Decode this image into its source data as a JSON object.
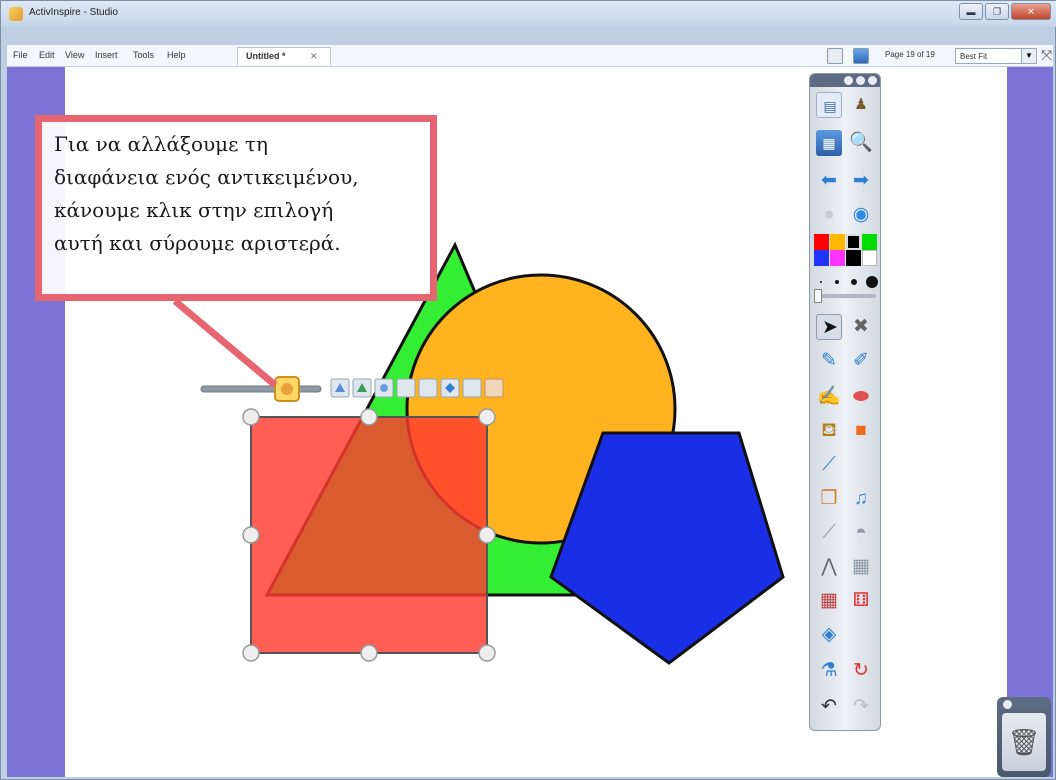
{
  "window": {
    "title": "ActivInspire - Studio"
  },
  "menu": {
    "items": [
      "File",
      "Edit",
      "View",
      "Insert",
      "Tools",
      "Help"
    ],
    "doc_tab": "Untitled *",
    "doc_tab_close": "✕"
  },
  "page_indicator": "Page 19 of 19",
  "zoom": {
    "selected": "Best Fit"
  },
  "callout": {
    "lines": [
      "Για να αλλάξουμε τη",
      "διαφάνεια ενός αντικειμένου,",
      "κάνουμε κλικ στην επιλογή",
      "αυτή και σύρουμε αριστερά."
    ]
  },
  "shapes": [
    {
      "name": "triangle",
      "color": "#33ee33",
      "transparent": false
    },
    {
      "name": "circle",
      "color": "#ffb31e",
      "transparent": false
    },
    {
      "name": "pentagon",
      "color": "#1a2ee6",
      "transparent": false
    },
    {
      "name": "square",
      "color": "#ff3b2f",
      "transparent": true,
      "selected": true
    }
  ],
  "colors": {
    "accent": "#e76571",
    "canvas_margin": "#7b73d6",
    "palette": [
      "#ff0000",
      "#ffb800",
      "#000000",
      "#00dd00",
      "#2233ff",
      "#ff33ff",
      "#000000",
      "#ffffff"
    ]
  },
  "toolbox_icons": [
    "page-browser-icon",
    "presenter-icon",
    "flipchart-icon",
    "zoom-icon",
    "previous-page-icon",
    "next-page-icon",
    "disabled-icon",
    "web-browser-icon",
    "select-icon",
    "tools-icon",
    "pen-icon",
    "highlighter-icon",
    "magic-ink-icon",
    "eraser-icon",
    "fill-icon",
    "shape-icon",
    "connector-icon",
    "resource-icon",
    "media-icon",
    "ruler-icon",
    "protractor-icon",
    "compass-icon",
    "calculator-icon",
    "grid-icon",
    "dice-icon",
    "spotlight-icon",
    "clear-icon",
    "reset-icon",
    "undo-icon",
    "redo-icon"
  ],
  "object_toolbar_icons": [
    "transparency-slider-icon",
    "to-front-icon",
    "to-back-icon",
    "group-icon",
    "lock-icon",
    "duplicate-icon",
    "edit-shape-icon",
    "menu-icon"
  ],
  "trash_icon": "trash-icon"
}
